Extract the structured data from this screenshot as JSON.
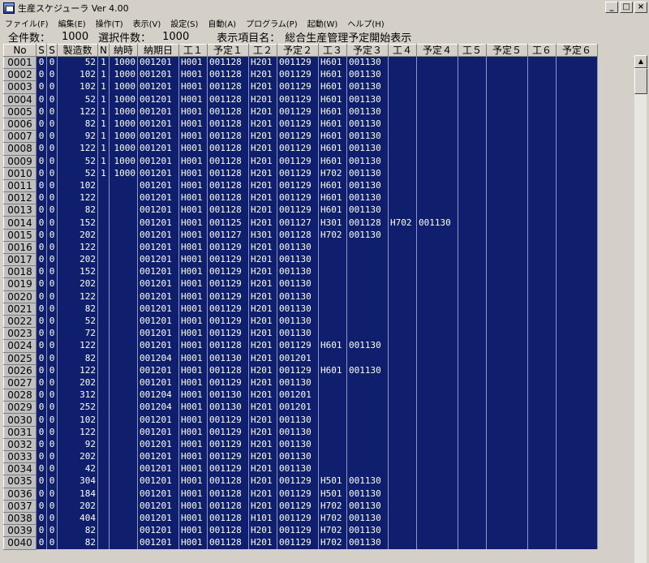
{
  "window": {
    "title": "生産スケジューラ  Ver 4.00"
  },
  "menu": [
    "ファイル(F)",
    "編集(E)",
    "操作(T)",
    "表示(V)",
    "設定(S)",
    "自動(A)",
    "プログラム(P)",
    "起動(W)",
    "ヘルプ(H)"
  ],
  "summary": {
    "total_label": "全件数：",
    "total_value": "1000",
    "selected_label": "選択件数：",
    "selected_value": "1000",
    "display_label": "表示項目名：",
    "display_value": "総合生産管理予定開始表示"
  },
  "columns": [
    "No",
    "S",
    "S",
    "製造数",
    "N",
    "納時",
    "納期日",
    "工１",
    "予定１",
    "工２",
    "予定２",
    "工３",
    "予定３",
    "工４",
    "予定４",
    "工５",
    "予定５",
    "工６",
    "予定６"
  ],
  "rows": [
    [
      "0001",
      "0",
      "0",
      "52",
      "1",
      "1000",
      "001201",
      "H001",
      "001128",
      "H201",
      "001129",
      "H601",
      "001130",
      "",
      "",
      "",
      "",
      "",
      ""
    ],
    [
      "0002",
      "0",
      "0",
      "102",
      "1",
      "1000",
      "001201",
      "H001",
      "001128",
      "H201",
      "001129",
      "H601",
      "001130",
      "",
      "",
      "",
      "",
      "",
      ""
    ],
    [
      "0003",
      "0",
      "0",
      "102",
      "1",
      "1000",
      "001201",
      "H001",
      "001128",
      "H201",
      "001129",
      "H601",
      "001130",
      "",
      "",
      "",
      "",
      "",
      ""
    ],
    [
      "0004",
      "0",
      "0",
      "52",
      "1",
      "1000",
      "001201",
      "H001",
      "001128",
      "H201",
      "001129",
      "H601",
      "001130",
      "",
      "",
      "",
      "",
      "",
      ""
    ],
    [
      "0005",
      "0",
      "0",
      "122",
      "1",
      "1000",
      "001201",
      "H001",
      "001128",
      "H201",
      "001129",
      "H601",
      "001130",
      "",
      "",
      "",
      "",
      "",
      ""
    ],
    [
      "0006",
      "0",
      "0",
      "82",
      "1",
      "1000",
      "001201",
      "H001",
      "001128",
      "H201",
      "001129",
      "H601",
      "001130",
      "",
      "",
      "",
      "",
      "",
      ""
    ],
    [
      "0007",
      "0",
      "0",
      "92",
      "1",
      "1000",
      "001201",
      "H001",
      "001128",
      "H201",
      "001129",
      "H601",
      "001130",
      "",
      "",
      "",
      "",
      "",
      ""
    ],
    [
      "0008",
      "0",
      "0",
      "122",
      "1",
      "1000",
      "001201",
      "H001",
      "001128",
      "H201",
      "001129",
      "H601",
      "001130",
      "",
      "",
      "",
      "",
      "",
      ""
    ],
    [
      "0009",
      "0",
      "0",
      "52",
      "1",
      "1000",
      "001201",
      "H001",
      "001128",
      "H201",
      "001129",
      "H601",
      "001130",
      "",
      "",
      "",
      "",
      "",
      ""
    ],
    [
      "0010",
      "0",
      "0",
      "52",
      "1",
      "1000",
      "001201",
      "H001",
      "001128",
      "H201",
      "001129",
      "H702",
      "001130",
      "",
      "",
      "",
      "",
      "",
      ""
    ],
    [
      "0011",
      "0",
      "0",
      "102",
      "",
      "",
      "001201",
      "H001",
      "001128",
      "H201",
      "001129",
      "H601",
      "001130",
      "",
      "",
      "",
      "",
      "",
      ""
    ],
    [
      "0012",
      "0",
      "0",
      "122",
      "",
      "",
      "001201",
      "H001",
      "001128",
      "H201",
      "001129",
      "H601",
      "001130",
      "",
      "",
      "",
      "",
      "",
      ""
    ],
    [
      "0013",
      "0",
      "0",
      "82",
      "",
      "",
      "001201",
      "H001",
      "001128",
      "H201",
      "001129",
      "H601",
      "001130",
      "",
      "",
      "",
      "",
      "",
      ""
    ],
    [
      "0014",
      "0",
      "0",
      "152",
      "",
      "",
      "001201",
      "H001",
      "001125",
      "H201",
      "001127",
      "H301",
      "001128",
      "H702",
      "001130",
      "",
      "",
      "",
      ""
    ],
    [
      "0015",
      "0",
      "0",
      "202",
      "",
      "",
      "001201",
      "H001",
      "001127",
      "H301",
      "001128",
      "H702",
      "001130",
      "",
      "",
      "",
      "",
      "",
      ""
    ],
    [
      "0016",
      "0",
      "0",
      "122",
      "",
      "",
      "001201",
      "H001",
      "001129",
      "H201",
      "001130",
      "",
      "",
      "",
      "",
      "",
      "",
      "",
      ""
    ],
    [
      "0017",
      "0",
      "0",
      "202",
      "",
      "",
      "001201",
      "H001",
      "001129",
      "H201",
      "001130",
      "",
      "",
      "",
      "",
      "",
      "",
      "",
      ""
    ],
    [
      "0018",
      "0",
      "0",
      "152",
      "",
      "",
      "001201",
      "H001",
      "001129",
      "H201",
      "001130",
      "",
      "",
      "",
      "",
      "",
      "",
      "",
      ""
    ],
    [
      "0019",
      "0",
      "0",
      "202",
      "",
      "",
      "001201",
      "H001",
      "001129",
      "H201",
      "001130",
      "",
      "",
      "",
      "",
      "",
      "",
      "",
      ""
    ],
    [
      "0020",
      "0",
      "0",
      "122",
      "",
      "",
      "001201",
      "H001",
      "001129",
      "H201",
      "001130",
      "",
      "",
      "",
      "",
      "",
      "",
      "",
      ""
    ],
    [
      "0021",
      "0",
      "0",
      "82",
      "",
      "",
      "001201",
      "H001",
      "001129",
      "H201",
      "001130",
      "",
      "",
      "",
      "",
      "",
      "",
      "",
      ""
    ],
    [
      "0022",
      "0",
      "0",
      "52",
      "",
      "",
      "001201",
      "H001",
      "001129",
      "H201",
      "001130",
      "",
      "",
      "",
      "",
      "",
      "",
      "",
      ""
    ],
    [
      "0023",
      "0",
      "0",
      "72",
      "",
      "",
      "001201",
      "H001",
      "001129",
      "H201",
      "001130",
      "",
      "",
      "",
      "",
      "",
      "",
      "",
      ""
    ],
    [
      "0024",
      "0",
      "0",
      "122",
      "",
      "",
      "001201",
      "H001",
      "001128",
      "H201",
      "001129",
      "H601",
      "001130",
      "",
      "",
      "",
      "",
      "",
      ""
    ],
    [
      "0025",
      "0",
      "0",
      "82",
      "",
      "",
      "001204",
      "H001",
      "001130",
      "H201",
      "001201",
      "",
      "",
      "",
      "",
      "",
      "",
      "",
      ""
    ],
    [
      "0026",
      "0",
      "0",
      "122",
      "",
      "",
      "001201",
      "H001",
      "001128",
      "H201",
      "001129",
      "H601",
      "001130",
      "",
      "",
      "",
      "",
      "",
      ""
    ],
    [
      "0027",
      "0",
      "0",
      "202",
      "",
      "",
      "001201",
      "H001",
      "001129",
      "H201",
      "001130",
      "",
      "",
      "",
      "",
      "",
      "",
      "",
      ""
    ],
    [
      "0028",
      "0",
      "0",
      "312",
      "",
      "",
      "001204",
      "H001",
      "001130",
      "H201",
      "001201",
      "",
      "",
      "",
      "",
      "",
      "",
      "",
      ""
    ],
    [
      "0029",
      "0",
      "0",
      "252",
      "",
      "",
      "001204",
      "H001",
      "001130",
      "H201",
      "001201",
      "",
      "",
      "",
      "",
      "",
      "",
      "",
      ""
    ],
    [
      "0030",
      "0",
      "0",
      "102",
      "",
      "",
      "001201",
      "H001",
      "001129",
      "H201",
      "001130",
      "",
      "",
      "",
      "",
      "",
      "",
      "",
      ""
    ],
    [
      "0031",
      "0",
      "0",
      "122",
      "",
      "",
      "001201",
      "H001",
      "001129",
      "H201",
      "001130",
      "",
      "",
      "",
      "",
      "",
      "",
      "",
      ""
    ],
    [
      "0032",
      "0",
      "0",
      "92",
      "",
      "",
      "001201",
      "H001",
      "001129",
      "H201",
      "001130",
      "",
      "",
      "",
      "",
      "",
      "",
      "",
      ""
    ],
    [
      "0033",
      "0",
      "0",
      "202",
      "",
      "",
      "001201",
      "H001",
      "001129",
      "H201",
      "001130",
      "",
      "",
      "",
      "",
      "",
      "",
      "",
      ""
    ],
    [
      "0034",
      "0",
      "0",
      "42",
      "",
      "",
      "001201",
      "H001",
      "001129",
      "H201",
      "001130",
      "",
      "",
      "",
      "",
      "",
      "",
      "",
      ""
    ],
    [
      "0035",
      "0",
      "0",
      "304",
      "",
      "",
      "001201",
      "H001",
      "001128",
      "H201",
      "001129",
      "H501",
      "001130",
      "",
      "",
      "",
      "",
      "",
      ""
    ],
    [
      "0036",
      "0",
      "0",
      "184",
      "",
      "",
      "001201",
      "H001",
      "001128",
      "H201",
      "001129",
      "H501",
      "001130",
      "",
      "",
      "",
      "",
      "",
      ""
    ],
    [
      "0037",
      "0",
      "0",
      "202",
      "",
      "",
      "001201",
      "H001",
      "001128",
      "H201",
      "001129",
      "H702",
      "001130",
      "",
      "",
      "",
      "",
      "",
      ""
    ],
    [
      "0038",
      "0",
      "0",
      "404",
      "",
      "",
      "001201",
      "H001",
      "001128",
      "H101",
      "001129",
      "H702",
      "001130",
      "",
      "",
      "",
      "",
      "",
      ""
    ],
    [
      "0039",
      "0",
      "0",
      "82",
      "",
      "",
      "001201",
      "H001",
      "001128",
      "H201",
      "001129",
      "H702",
      "001130",
      "",
      "",
      "",
      "",
      "",
      ""
    ],
    [
      "0040",
      "0",
      "0",
      "82",
      "",
      "",
      "001201",
      "H001",
      "001128",
      "H201",
      "001129",
      "H702",
      "001130",
      "",
      "",
      "",
      "",
      "",
      ""
    ]
  ],
  "colors": {
    "grid_bg": "#0f1f6e",
    "grid_text": "#ffffff",
    "chrome": "#d4d0c8"
  }
}
